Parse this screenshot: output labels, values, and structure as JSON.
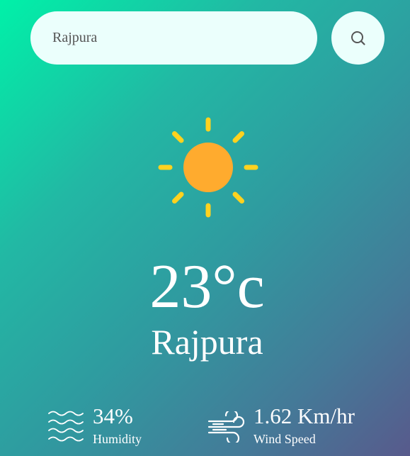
{
  "search": {
    "value": "Rajpura",
    "icon": "search-icon"
  },
  "weather": {
    "icon": "sun-icon",
    "temperature": "23°c",
    "city": "Rajpura"
  },
  "details": {
    "humidity": {
      "icon": "humidity-waves-icon",
      "value": "34%",
      "label": "Humidity"
    },
    "wind": {
      "icon": "wind-icon",
      "value": "1.62 Km/hr",
      "label": "Wind Speed"
    }
  },
  "colors": {
    "gradient_start": "#00f1a8",
    "gradient_end": "#585a8c",
    "field_background": "#ebfffc",
    "sun_core": "#ffad33",
    "sun_rays": "#ffd21f"
  }
}
